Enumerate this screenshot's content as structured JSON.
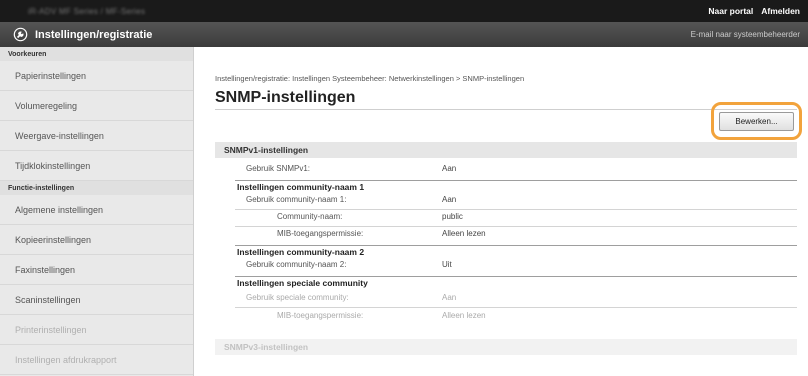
{
  "header": {
    "device_name": "iR-ADV MF Series / MF-Series",
    "portal_link": "Naar portal",
    "logout_link": "Afmelden"
  },
  "titlebar": {
    "app_icon": "settings-gear-icon",
    "title": "Instellingen/registratie",
    "sysadmin_link": "E-mail naar systeembeheerder"
  },
  "sidebar": {
    "cat_preferences": "Voorkeuren",
    "preferences": [
      "Papierinstellingen",
      "Volumeregeling",
      "Weergave-instellingen",
      "Tijdklokinstellingen"
    ],
    "cat_functions": "Functie-instellingen",
    "functions": [
      "Algemene instellingen",
      "Kopieerinstellingen",
      "Faxinstellingen",
      "Scaninstellingen",
      "Printerinstellingen",
      "Instellingen afdrukrapport"
    ]
  },
  "main": {
    "breadcrumb": "Instellingen/registratie: Instellingen Systeembeheer: Netwerkinstellingen > SNMP-instellingen",
    "title": "SNMP-instellingen",
    "edit_button": "Bewerken...",
    "snmpv1": {
      "heading": "SNMPv1-instellingen",
      "use_label": "Gebruik SNMPv1:",
      "use_value": "Aan",
      "community1_heading": "Instellingen community-naam 1",
      "community1_use_label": "Gebruik community-naam 1:",
      "community1_use_value": "Aan",
      "community_name_label": "Community-naam:",
      "community_name_value": "public",
      "mib_access_label": "MIB-toegangspermissie:",
      "mib_access_value": "Alleen lezen",
      "community2_heading": "Instellingen community-naam 2",
      "community2_use_label": "Gebruik community-naam 2:",
      "community2_use_value": "Uit",
      "special_heading": "Instellingen speciale community",
      "special_use_label": "Gebruik speciale community:",
      "special_use_value": "Aan",
      "special_mib_label": "MIB-toegangspermissie:",
      "special_mib_value": "Alleen lezen"
    },
    "snmpv3_heading": "SNMPv3-instellingen"
  },
  "colors": {
    "highlight": "#f2a33c",
    "topbar": "#1a1a1a",
    "titlebar": "#444444",
    "sidebar": "#e9e9e9"
  }
}
